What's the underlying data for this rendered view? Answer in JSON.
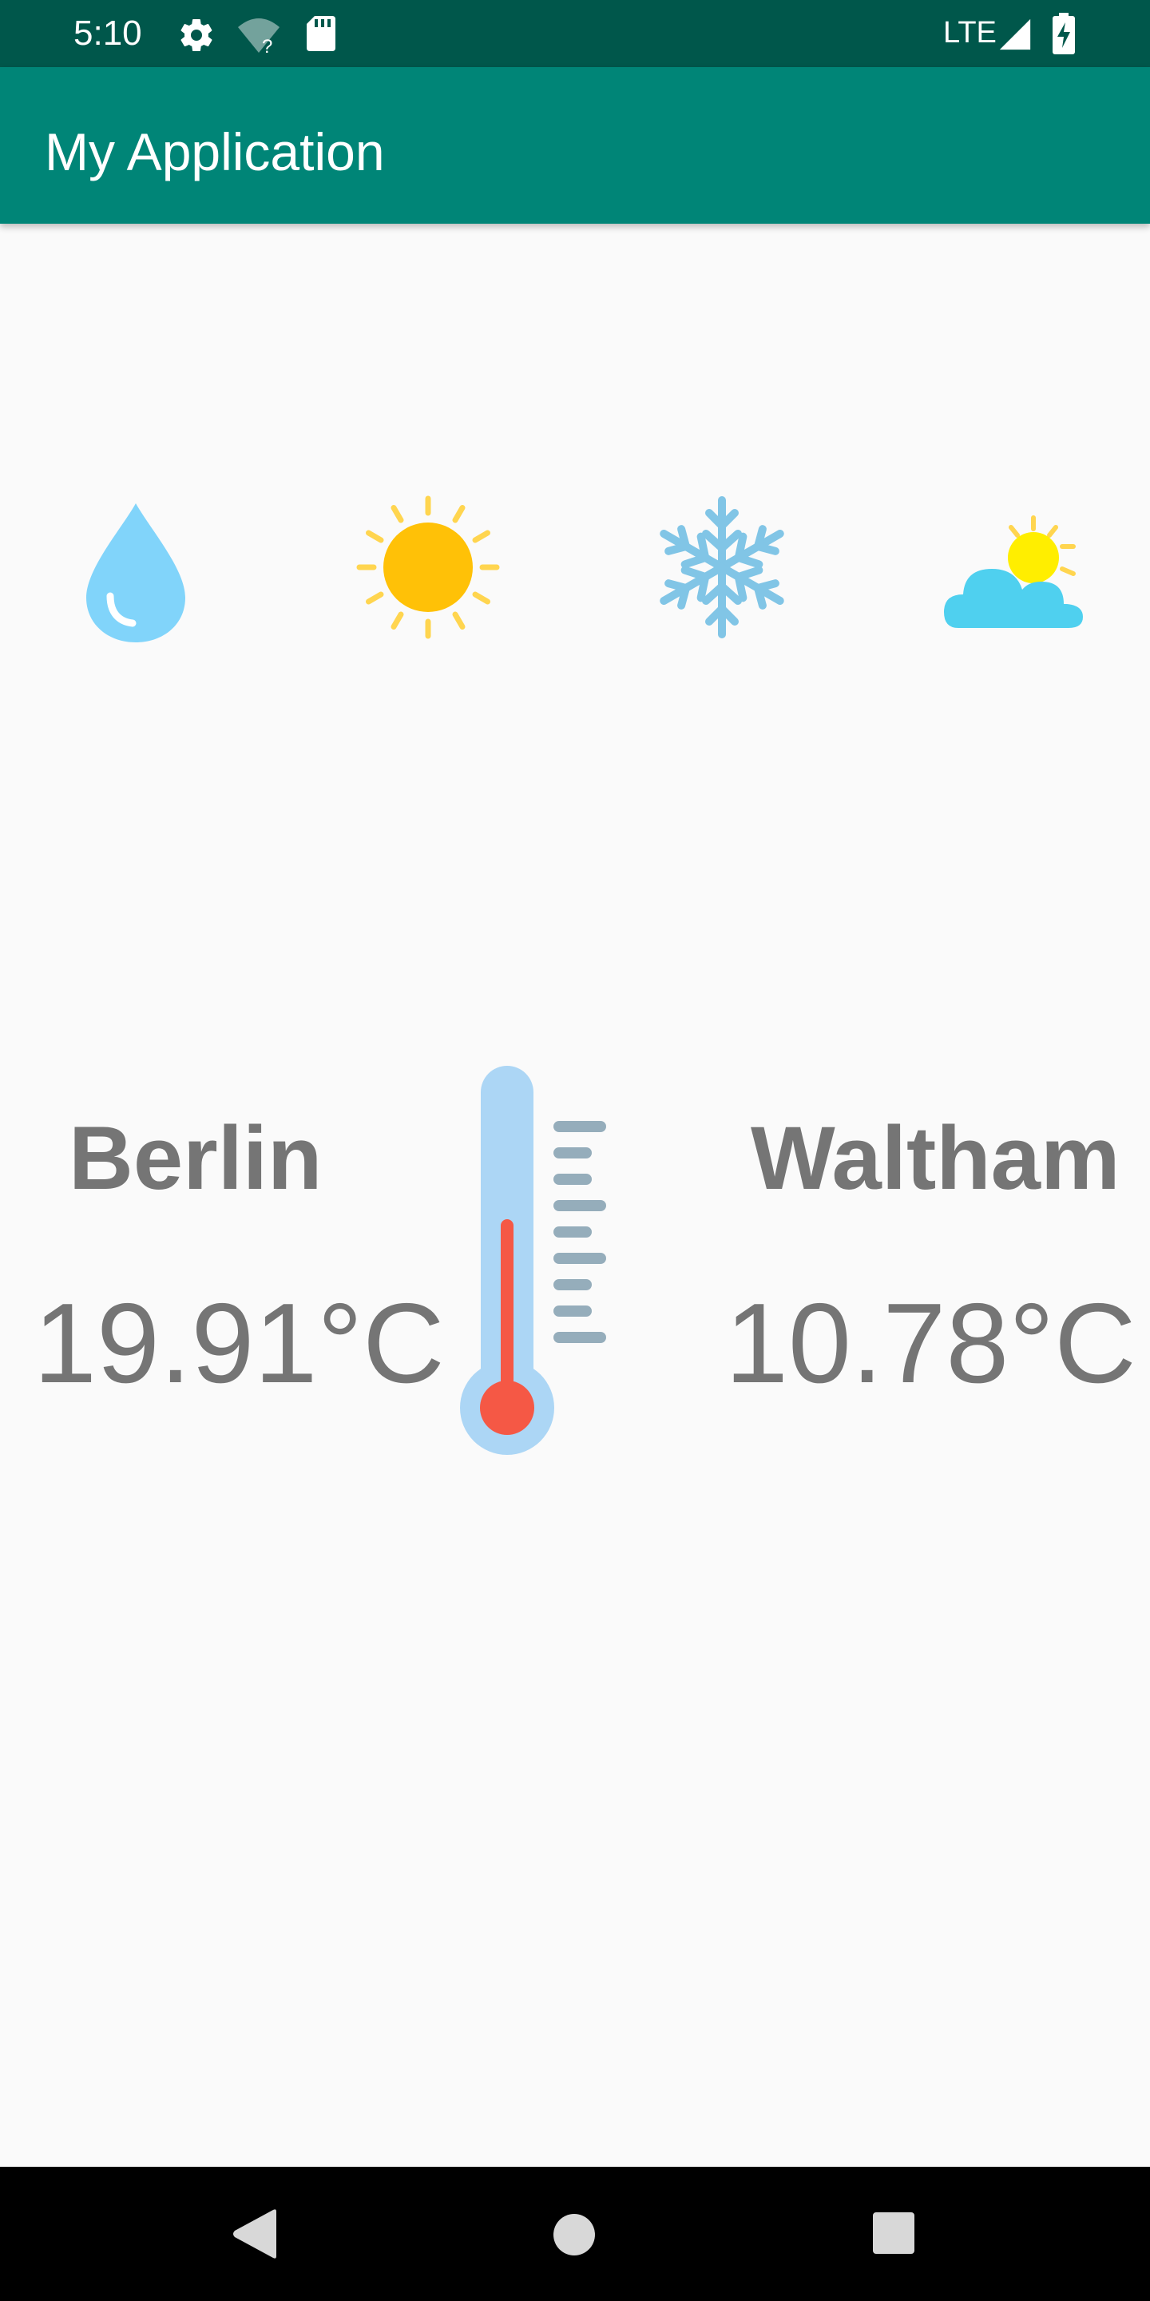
{
  "status_bar": {
    "time": "5:10",
    "network": "LTE",
    "icons": [
      "gear-icon",
      "wifi-question-icon",
      "sd-card-icon",
      "signal-icon",
      "battery-charging-icon"
    ]
  },
  "app_bar": {
    "title": "My Application",
    "color": "#008577"
  },
  "weather_icons": [
    "water-drop-icon",
    "sun-icon",
    "snowflake-icon",
    "partly-cloudy-icon"
  ],
  "cities": [
    {
      "name": "Berlin",
      "temperature": "19.91°C"
    },
    {
      "name": "Waltham",
      "temperature": "10.78°C"
    }
  ],
  "center_icon": "thermometer-icon",
  "nav_bar": {
    "buttons": [
      "back-icon",
      "home-icon",
      "recents-icon"
    ]
  },
  "colors": {
    "status_bar": "#00574b",
    "text_gray": "#757575",
    "drop_blue": "#81d4fa",
    "sun_yellow": "#ffc107",
    "snow_blue": "#81c5e6",
    "cloud_blue": "#4fd0ef",
    "thermo_red": "#f55845"
  }
}
